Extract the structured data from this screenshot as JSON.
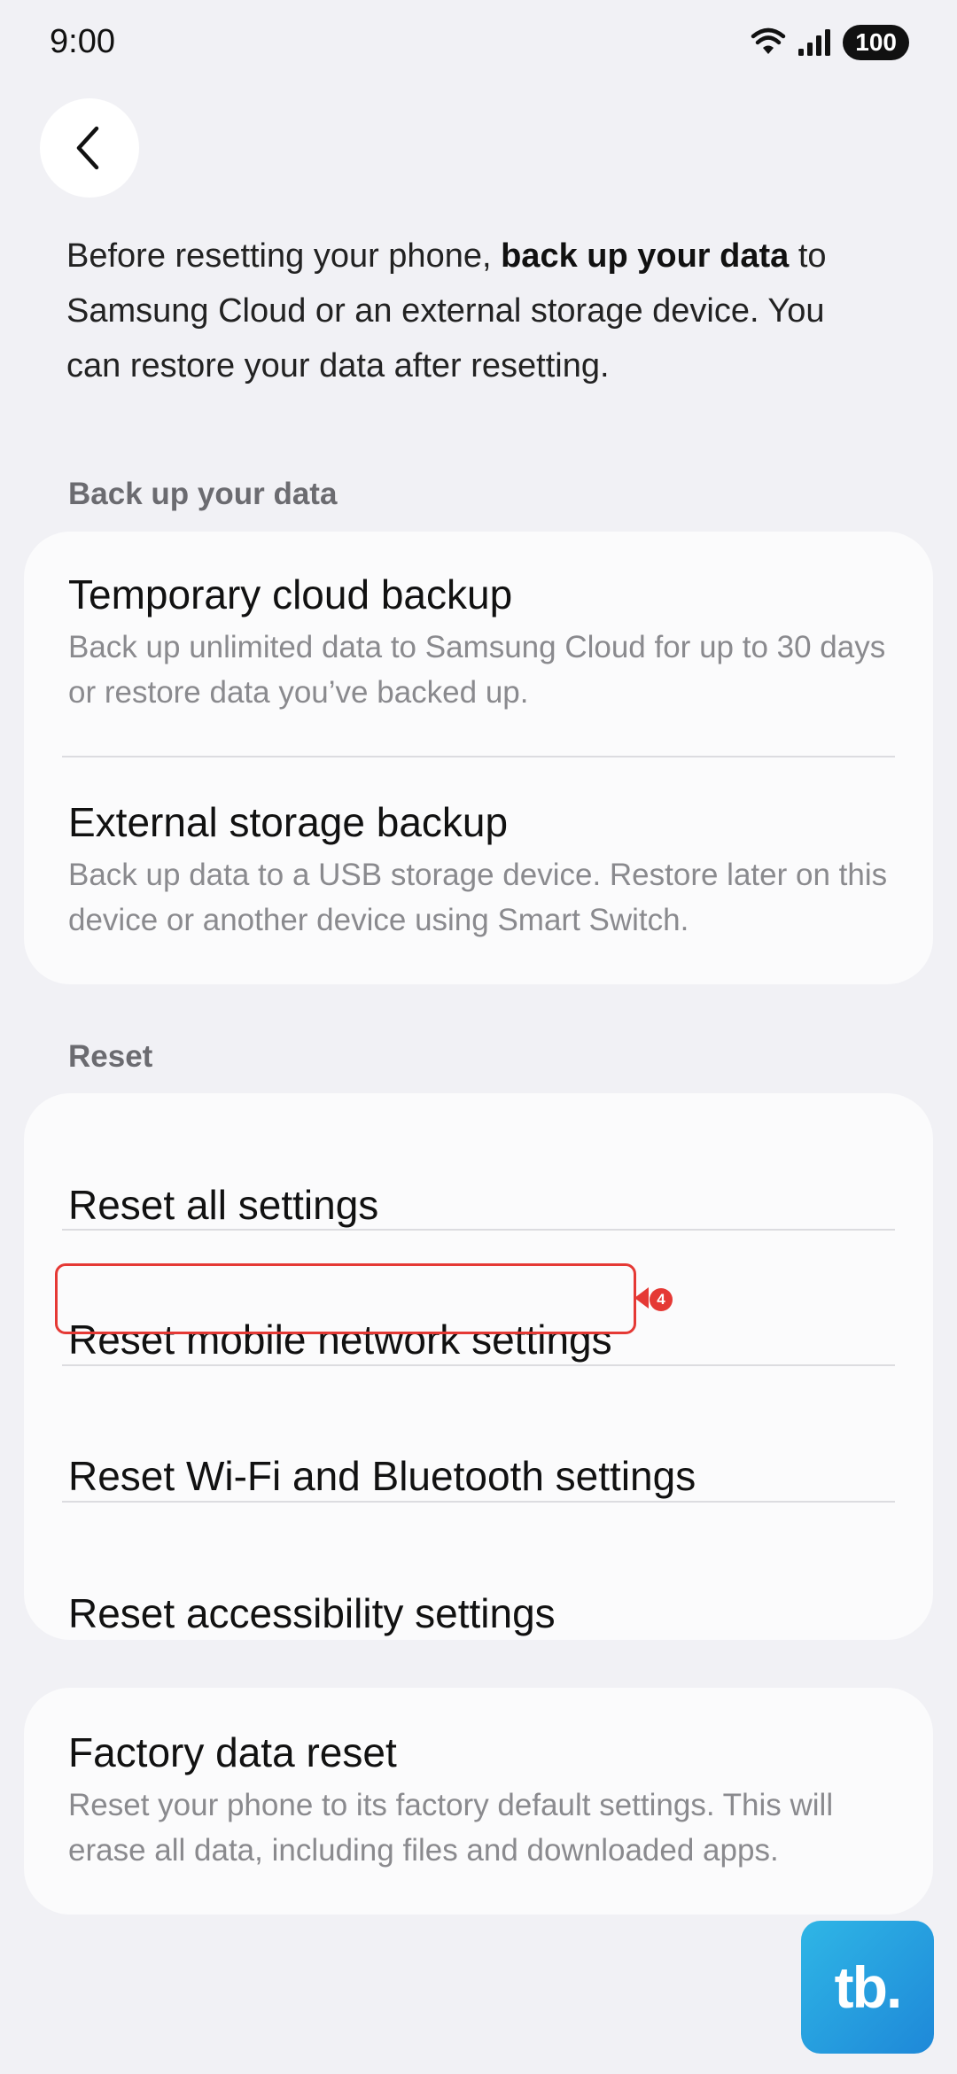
{
  "status_bar": {
    "time": "9:00",
    "battery": "100",
    "icons": [
      "wifi-icon",
      "signal-icon",
      "battery-icon"
    ]
  },
  "header": {
    "back_icon": "chevron-left-icon"
  },
  "intro": {
    "part1": "Before resetting your phone, ",
    "bold": "back up your data",
    "part2": " to Samsung Cloud or an external storage device. You can restore your data after resetting."
  },
  "backup_section": {
    "label": "Back up your data",
    "items": [
      {
        "title": "Temporary cloud backup",
        "description": "Back up unlimited data to Samsung Cloud for up to 30 days or restore data you’ve backed up."
      },
      {
        "title": "External storage backup",
        "description": "Back up data to a USB storage device. Restore later on this device or another device using Smart Switch."
      }
    ]
  },
  "reset_section": {
    "label": "Reset",
    "items": [
      {
        "title": "Reset all settings"
      },
      {
        "title": "Reset mobile network settings"
      },
      {
        "title": "Reset Wi-Fi and Bluetooth settings"
      },
      {
        "title": "Reset accessibility settings"
      }
    ]
  },
  "factory_section": {
    "title": "Factory data reset",
    "description": "Reset your phone to its factory default settings. This will erase all data, including files and downloaded apps."
  },
  "annotation": {
    "step_number": "4",
    "color": "#e53935"
  },
  "brand": {
    "logo_text": "tb."
  },
  "colors": {
    "background": "#f1f1f5",
    "card": "#fbfbfc",
    "secondary_text": "#8a8a8e",
    "section_label": "#6b6b70"
  }
}
